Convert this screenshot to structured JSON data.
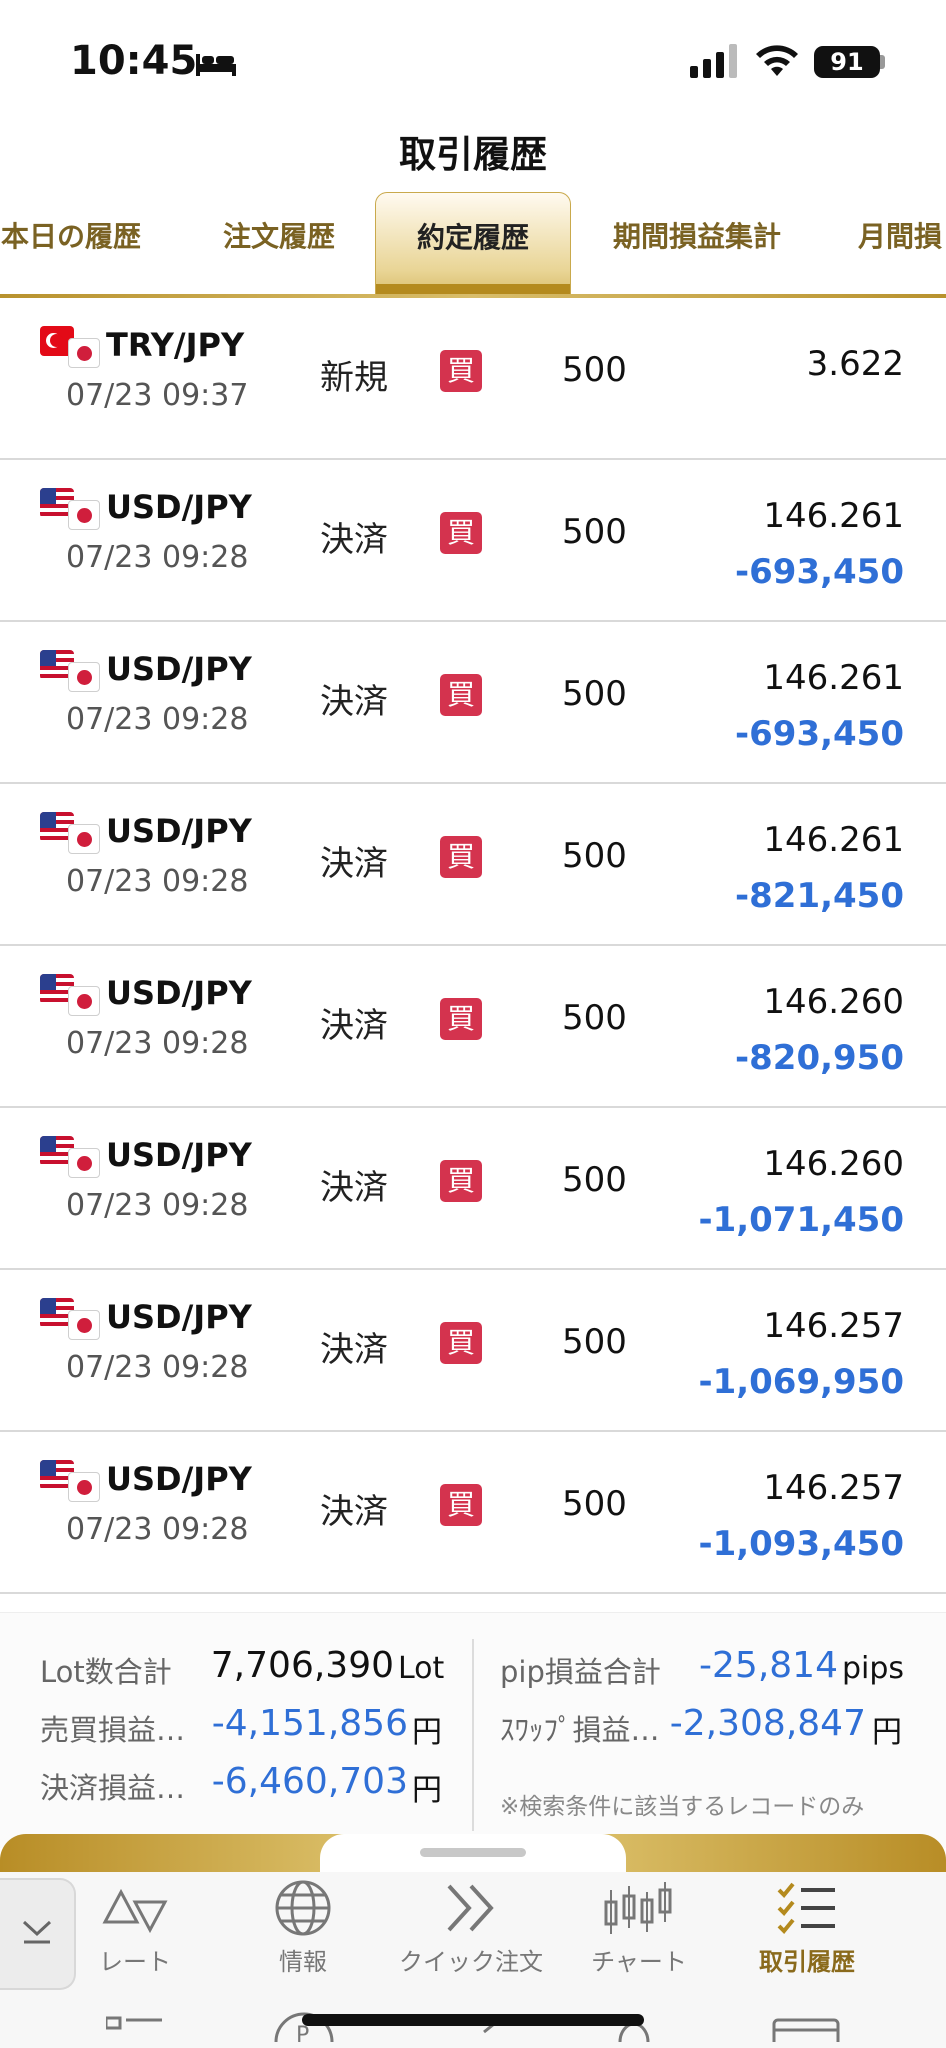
{
  "status_bar": {
    "time": "10:45",
    "battery": "91"
  },
  "title": "取引履歴",
  "tabs": [
    {
      "label": "本日の履歴",
      "active": false
    },
    {
      "label": "注文履歴",
      "active": false
    },
    {
      "label": "約定履歴",
      "active": true
    },
    {
      "label": "期間損益集計",
      "active": false
    },
    {
      "label": "月間損",
      "active": false
    }
  ],
  "side_badge": "買",
  "rows": [
    {
      "pair": "TRY/JPY",
      "flag": "turkey-japan-flag-icon",
      "time": "07/23 09:37",
      "type": "新規",
      "qty": "500",
      "price": "3.622",
      "pnl": ""
    },
    {
      "pair": "USD/JPY",
      "flag": "us-japan-flag-icon",
      "time": "07/23 09:28",
      "type": "決済",
      "qty": "500",
      "price": "146.261",
      "pnl": "-693,450"
    },
    {
      "pair": "USD/JPY",
      "flag": "us-japan-flag-icon",
      "time": "07/23 09:28",
      "type": "決済",
      "qty": "500",
      "price": "146.261",
      "pnl": "-693,450"
    },
    {
      "pair": "USD/JPY",
      "flag": "us-japan-flag-icon",
      "time": "07/23 09:28",
      "type": "決済",
      "qty": "500",
      "price": "146.261",
      "pnl": "-821,450"
    },
    {
      "pair": "USD/JPY",
      "flag": "us-japan-flag-icon",
      "time": "07/23 09:28",
      "type": "決済",
      "qty": "500",
      "price": "146.260",
      "pnl": "-820,950"
    },
    {
      "pair": "USD/JPY",
      "flag": "us-japan-flag-icon",
      "time": "07/23 09:28",
      "type": "決済",
      "qty": "500",
      "price": "146.260",
      "pnl": "-1,071,450"
    },
    {
      "pair": "USD/JPY",
      "flag": "us-japan-flag-icon",
      "time": "07/23 09:28",
      "type": "決済",
      "qty": "500",
      "price": "146.257",
      "pnl": "-1,069,950"
    },
    {
      "pair": "USD/JPY",
      "flag": "us-japan-flag-icon",
      "time": "07/23 09:28",
      "type": "決済",
      "qty": "500",
      "price": "146.257",
      "pnl": "-1,093,450"
    }
  ],
  "summary": {
    "lot_label": "Lot数合計",
    "lot_value": "7,706,390",
    "lot_unit": "Lot",
    "trade_label": "売買損益…",
    "trade_value": "-4,151,856",
    "trade_unit": "円",
    "settle_label": "決済損益…",
    "settle_value": "-6,460,703",
    "settle_unit": "円",
    "pip_label": "pip損益合計",
    "pip_value": "-25,814",
    "pip_unit": "pips",
    "swap_label": "ｽﾜｯﾌﾟ損益…",
    "swap_value": "-2,308,847",
    "swap_unit": "円",
    "note": "※検索条件に該当するレコードのみ"
  },
  "nav": [
    {
      "label": "レート",
      "icon": "rate-icon"
    },
    {
      "label": "情報",
      "icon": "globe-icon"
    },
    {
      "label": "クイック注文",
      "icon": "quick-order-icon"
    },
    {
      "label": "チャート",
      "icon": "chart-icon"
    },
    {
      "label": "取引履歴",
      "icon": "history-icon",
      "active": true
    }
  ],
  "colors": {
    "accent_gold": "#b48a1e",
    "negative_blue": "#2f6fd6",
    "buy_red": "#d4334e"
  }
}
